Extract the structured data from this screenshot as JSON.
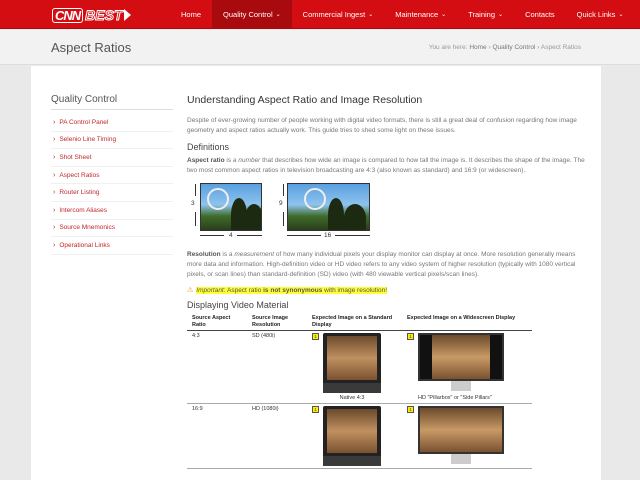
{
  "logo": {
    "cnn": "CNN",
    "best": "BEST"
  },
  "nav": [
    {
      "label": "Home",
      "caret": ""
    },
    {
      "label": "Quality Control",
      "caret": "⌄"
    },
    {
      "label": "Commercial Ingest",
      "caret": "⌄"
    },
    {
      "label": "Maintenance",
      "caret": "⌄"
    },
    {
      "label": "Training",
      "caret": "⌄"
    },
    {
      "label": "Contacts",
      "caret": ""
    },
    {
      "label": "Quick Links",
      "caret": "⌄"
    }
  ],
  "page_title": "Aspect Ratios",
  "breadcrumb": {
    "prefix": "You are here:",
    "home": "Home",
    "section": "Quality Control",
    "current": "Aspect Ratios",
    "sep": "›"
  },
  "sidebar": {
    "title": "Quality Control",
    "items": [
      "PA Control Panel",
      "Selenio Line Timing",
      "Shot Sheet",
      "Aspect Ratios",
      "Router Listing",
      "Intercom Aliases",
      "Source Mnemonics",
      "Operational Links"
    ]
  },
  "article": {
    "title": "Understanding Aspect Ratio and Image Resolution",
    "intro": "Despite of ever-growing number of people working with digital video formats, there is still a great deal of confusion regarding how image geometry and aspect ratios actually work. This guide tries to shed some light on these issues.",
    "definitions_heading": "Definitions",
    "aspect_term": "Aspect ratio",
    "aspect_is": " is ",
    "aspect_a_number": "a number",
    "aspect_rest": " that describes how wide an image is compared to how tall the image is. It describes the shape of the image. The two most common aspect ratios in television broadcasting are 4:3 (also known as standard) and 16:9 (or widescreen).",
    "dim_43_h": "3",
    "dim_43_w": "4",
    "dim_169_h": "9",
    "dim_169_w": "16",
    "resolution_term": "Resolution",
    "resolution_is": " is a ",
    "resolution_measurement": "measurement",
    "resolution_rest": " of how many individual pixels your display monitor can display at once. More resolution generally means more data and information. High-definition video or HD video refers to any video system of higher resolution (typically with 1080 vertical pixels, or scan lines) than standard-definition (SD) video (with 480 viewable vertical pixels/scan lines).",
    "important_label": "Important:",
    "important_a": " Aspect ratio ",
    "important_b": "is not synonymous",
    "important_c": " with image resolution!",
    "display_heading": "Displaying Video Material",
    "table_headers": [
      "Source Aspect Ratio",
      "Source Image Resolution",
      "Expected Image on a Standard Display",
      "Expected Image on a Widescreen Display"
    ],
    "rows": [
      {
        "ratio": "4:3",
        "res": "SD (480i)",
        "std_num": "1",
        "std_cap": "Native 4:3",
        "wide_num": "1",
        "wide_cap": "HD \"Pillarbox\" or \"Side Pillars\""
      },
      {
        "ratio": "16:9",
        "res": "HD (1080i)",
        "std_num": "1",
        "std_cap": "",
        "wide_num": "1",
        "wide_cap": ""
      }
    ]
  },
  "colors": {
    "brand_red": "#d40d12",
    "link_red": "#c0282d",
    "highlight": "#ffff33"
  }
}
